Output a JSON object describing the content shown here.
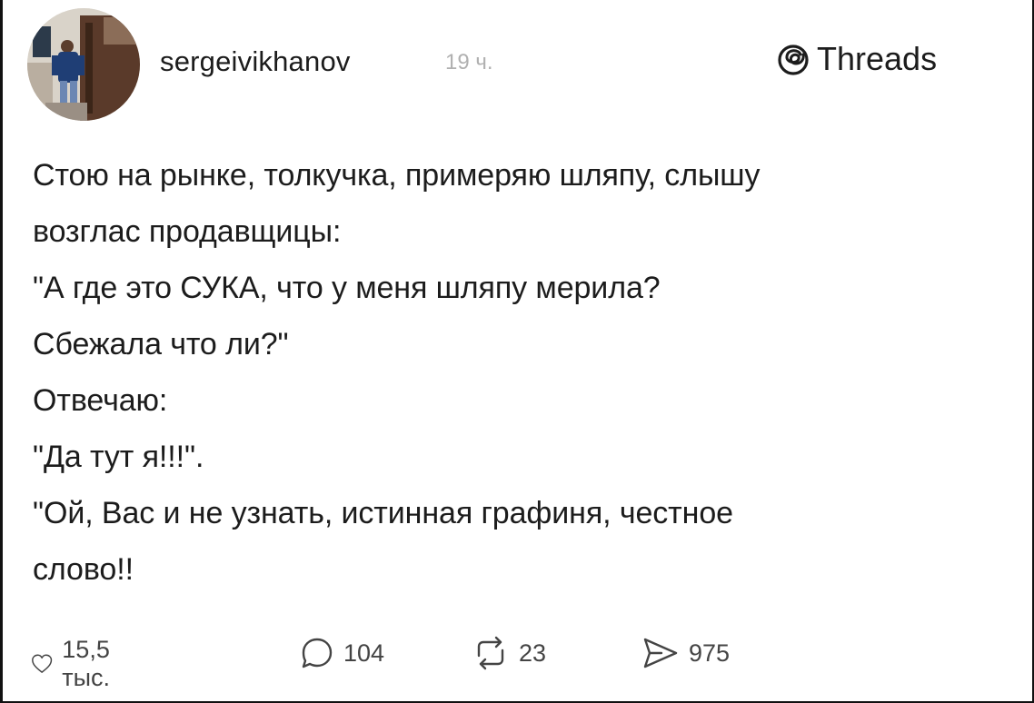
{
  "post": {
    "author": {
      "username": "sergeivikhanov",
      "posted_ago": "19 ч."
    },
    "brand": {
      "name": "Threads",
      "icon": "threads-logo-icon"
    },
    "lines": [
      "Стою на рынке, толкучка, примеряю шляпу, слышу",
      "возглас продавщицы:",
      "\"А где это СУКА, что у меня шляпу мерила?",
      "Сбежала что ли?\"",
      "Отвечаю:",
      "\"Да тут я!!!\".",
      "\"Ой, Вас и не узнать, истинная графиня, честное",
      "слово!!"
    ],
    "actions": {
      "likes": {
        "icon": "heart-icon",
        "count": "15,5 тыс."
      },
      "replies": {
        "icon": "comment-icon",
        "count": "104"
      },
      "reposts": {
        "icon": "repost-icon",
        "count": "23"
      },
      "shares": {
        "icon": "share-icon",
        "count": "975"
      }
    }
  }
}
